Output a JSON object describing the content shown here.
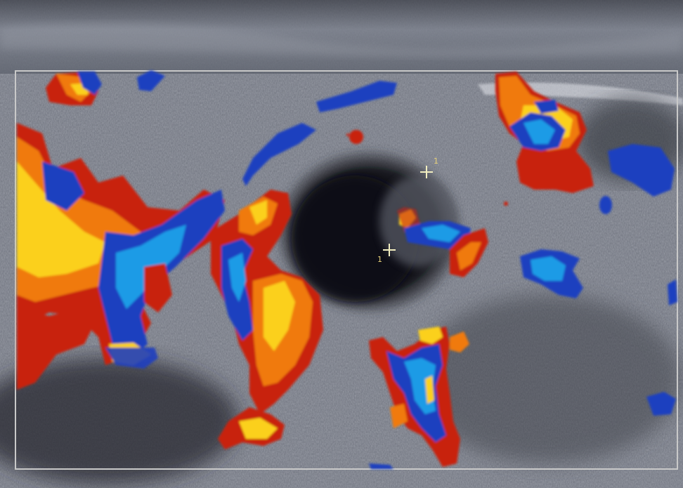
{
  "image": {
    "kind": "color-doppler-ultrasound"
  },
  "calipers": [
    {
      "marker": "+",
      "label": "1"
    },
    {
      "marker": "+",
      "label": "1"
    }
  ],
  "colors": {
    "background": "#2b2d33",
    "tissue": "#8a8e99",
    "tissue_light": "#c7cad2",
    "lesion": "#1a1b20",
    "color_box": "#c9c9c9",
    "doppler_red": "#c8200f",
    "doppler_orange": "#f07a10",
    "doppler_yellow": "#fbd01a",
    "doppler_blue": "#1f3fbf",
    "doppler_lightblue": "#1f9be6",
    "caliper": "#f2eec0"
  }
}
